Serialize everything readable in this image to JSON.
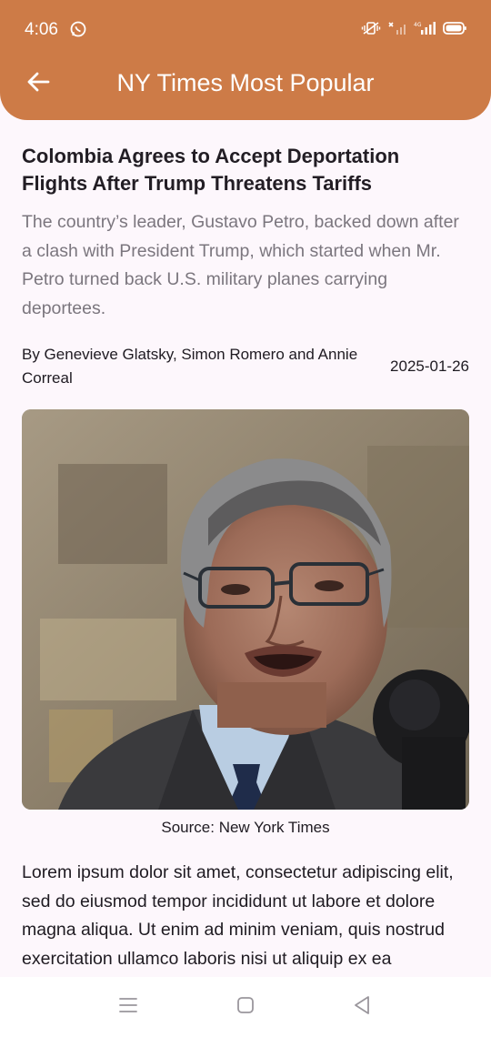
{
  "status_bar": {
    "time": "4:06",
    "icons": [
      "whatsapp-icon",
      "vibrate-icon",
      "no-signal-icon",
      "signal-4g-icon",
      "battery-icon"
    ]
  },
  "app_bar": {
    "title": "NY Times Most Popular",
    "back_icon": "arrow-back-icon"
  },
  "article": {
    "headline": "Colombia Agrees to Accept Deportation Flights After Trump Threatens Tariffs",
    "summary": "The country’s leader, Gustavo Petro, backed down after a clash with President Trump, which started when Mr. Petro turned back U.S. military planes carrying deportees.",
    "byline": "By Genevieve Glatsky, Simon Romero and Annie Correal",
    "date": "2025-01-26",
    "photo_caption": "Source: New York Times",
    "body": "Lorem ipsum dolor sit amet, consectetur adipiscing elit, sed do eiusmod tempor incididunt ut labore et dolore magna aliqua. Ut enim ad minim veniam, quis nostrud exercitation ullamco laboris nisi ut aliquip ex ea commodo consequat. Duis aute irure dolor in reprehenderit in voluptate velit esse cillum dolore eu fugiat nulla pariatur."
  },
  "colors": {
    "accent": "#cd7b47",
    "background": "#fdf7fc",
    "summary_text": "#7b767e"
  },
  "nav_bar": {
    "icons": [
      "menu-icon",
      "home-square-icon",
      "back-triangle-icon"
    ]
  }
}
